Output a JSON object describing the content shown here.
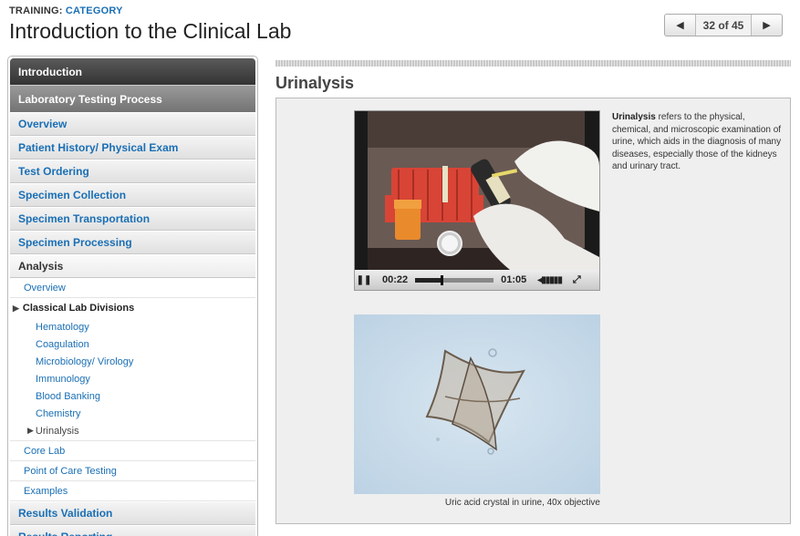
{
  "header": {
    "training_label": "TRAINING:",
    "category": "CATEGORY",
    "title": "Introduction to the Clinical Lab"
  },
  "pager": {
    "prev_icon": "triangle-left-icon",
    "count": "32 of 45",
    "next_icon": "triangle-right-icon"
  },
  "sidebar": {
    "top_items": [
      "Introduction",
      "Laboratory Testing Process"
    ],
    "items": [
      "Overview",
      "Patient History/ Physical Exam",
      "Test Ordering",
      "Specimen Collection",
      "Specimen Transportation",
      "Specimen Processing"
    ],
    "active_item": "Analysis",
    "analysis_sub": {
      "overview": "Overview",
      "classical": "Classical Lab Divisions",
      "divisions": [
        "Hematology",
        "Coagulation",
        "Microbiology/ Virology",
        "Immunology",
        "Blood Banking",
        "Chemistry"
      ],
      "current": "Urinalysis",
      "after": [
        "Core Lab",
        "Point of Care Testing",
        "Examples"
      ]
    },
    "bottom_items": [
      "Results Validation",
      "Results Reporting"
    ]
  },
  "main": {
    "section_title": "Urinalysis",
    "video": {
      "current_time": "00:22",
      "duration": "01:05",
      "progress": 0.34,
      "play_icon": "pause-icon",
      "volume_icon": "volume-icon",
      "fullscreen_icon": "fullscreen-icon"
    },
    "description_term": "Urinalysis",
    "description_text": " refers to the physical, chemical, and microscopic examination of urine, which aids in the diagnosis of many diseases, especially those of the kidneys and urinary tract.",
    "image_caption": "Uric acid crystal in urine, 40x objective"
  }
}
